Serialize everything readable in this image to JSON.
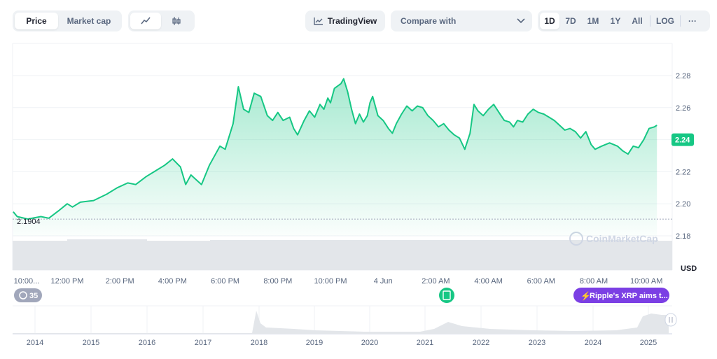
{
  "toolbar": {
    "metric_tabs": [
      {
        "label": "Price",
        "active": true
      },
      {
        "label": "Market cap",
        "active": false
      }
    ],
    "chart_style_icons": [
      "line-chart-icon",
      "candlestick-icon"
    ],
    "tradingview_label": "TradingView",
    "compare_label": "Compare with",
    "ranges": [
      {
        "label": "1D",
        "active": true
      },
      {
        "label": "7D",
        "active": false
      },
      {
        "label": "1M",
        "active": false
      },
      {
        "label": "1Y",
        "active": false
      },
      {
        "label": "All",
        "active": false
      },
      {
        "label": "LOG",
        "active": false
      }
    ],
    "more_label": "···"
  },
  "chart_data": {
    "type": "area",
    "y_ticks": [
      "2.18",
      "2.20",
      "2.22",
      "2.24",
      "2.26",
      "2.28"
    ],
    "ylim": [
      2.17,
      2.29
    ],
    "currency": "USD",
    "x_ticks": [
      "10:00...",
      "12:00 PM",
      "2:00 PM",
      "4:00 PM",
      "6:00 PM",
      "8:00 PM",
      "10:00 PM",
      "4 Jun",
      "2:00 AM",
      "4:00 AM",
      "6:00 AM",
      "8:00 AM",
      "10:00 AM"
    ],
    "x_hours": [
      0,
      2,
      4,
      6,
      8,
      10,
      12,
      14,
      16,
      18,
      20,
      22,
      24
    ],
    "open_price": 2.1904,
    "open_label": "2.1904",
    "current_price": 2.24,
    "current_label": "2.24",
    "series": [
      {
        "values": [
          [
            -0.05,
            2.195
          ],
          [
            0.1,
            2.192
          ],
          [
            0.5,
            2.1905
          ],
          [
            1.0,
            2.192
          ],
          [
            1.3,
            2.191
          ],
          [
            1.7,
            2.196
          ],
          [
            2.0,
            2.2
          ],
          [
            2.2,
            2.198
          ],
          [
            2.5,
            2.201
          ],
          [
            3.0,
            2.202
          ],
          [
            3.5,
            2.206
          ],
          [
            3.9,
            2.21
          ],
          [
            4.3,
            2.213
          ],
          [
            4.6,
            2.212
          ],
          [
            5.0,
            2.217
          ],
          [
            5.3,
            2.22
          ],
          [
            5.7,
            2.224
          ],
          [
            6.0,
            2.228
          ],
          [
            6.3,
            2.223
          ],
          [
            6.5,
            2.212
          ],
          [
            6.7,
            2.218
          ],
          [
            6.9,
            2.215
          ],
          [
            7.1,
            2.212
          ],
          [
            7.4,
            2.224
          ],
          [
            7.8,
            2.236
          ],
          [
            8.0,
            2.234
          ],
          [
            8.3,
            2.25
          ],
          [
            8.5,
            2.273
          ],
          [
            8.7,
            2.259
          ],
          [
            8.9,
            2.257
          ],
          [
            9.1,
            2.269
          ],
          [
            9.35,
            2.267
          ],
          [
            9.6,
            2.255
          ],
          [
            9.8,
            2.252
          ],
          [
            10.0,
            2.257
          ],
          [
            10.2,
            2.252
          ],
          [
            10.45,
            2.254
          ],
          [
            10.6,
            2.247
          ],
          [
            10.75,
            2.243
          ],
          [
            11.0,
            2.252
          ],
          [
            11.2,
            2.258
          ],
          [
            11.4,
            2.254
          ],
          [
            11.6,
            2.262
          ],
          [
            11.75,
            2.259
          ],
          [
            11.9,
            2.266
          ],
          [
            12.0,
            2.263
          ],
          [
            12.15,
            2.272
          ],
          [
            12.4,
            2.275
          ],
          [
            12.5,
            2.278
          ],
          [
            12.65,
            2.27
          ],
          [
            12.8,
            2.259
          ],
          [
            12.95,
            2.25
          ],
          [
            13.1,
            2.256
          ],
          [
            13.25,
            2.251
          ],
          [
            13.4,
            2.255
          ],
          [
            13.5,
            2.263
          ],
          [
            13.6,
            2.267
          ],
          [
            13.8,
            2.255
          ],
          [
            14.0,
            2.252
          ],
          [
            14.2,
            2.247
          ],
          [
            14.35,
            2.244
          ],
          [
            14.5,
            2.25
          ],
          [
            14.7,
            2.256
          ],
          [
            14.9,
            2.261
          ],
          [
            15.1,
            2.258
          ],
          [
            15.3,
            2.261
          ],
          [
            15.5,
            2.26
          ],
          [
            15.7,
            2.255
          ],
          [
            15.9,
            2.252
          ],
          [
            16.1,
            2.248
          ],
          [
            16.3,
            2.25
          ],
          [
            16.5,
            2.246
          ],
          [
            16.7,
            2.243
          ],
          [
            16.9,
            2.241
          ],
          [
            17.1,
            2.234
          ],
          [
            17.3,
            2.244
          ],
          [
            17.45,
            2.262
          ],
          [
            17.6,
            2.258
          ],
          [
            17.8,
            2.255
          ],
          [
            18.0,
            2.259
          ],
          [
            18.2,
            2.262
          ],
          [
            18.4,
            2.257
          ],
          [
            18.6,
            2.252
          ],
          [
            18.8,
            2.251
          ],
          [
            18.95,
            2.248
          ],
          [
            19.1,
            2.252
          ],
          [
            19.3,
            2.251
          ],
          [
            19.5,
            2.256
          ],
          [
            19.7,
            2.259
          ],
          [
            19.9,
            2.257
          ],
          [
            20.1,
            2.256
          ],
          [
            20.3,
            2.254
          ],
          [
            20.5,
            2.252
          ],
          [
            20.7,
            2.249
          ],
          [
            20.9,
            2.246
          ],
          [
            21.1,
            2.247
          ],
          [
            21.3,
            2.245
          ],
          [
            21.5,
            2.241
          ],
          [
            21.7,
            2.245
          ],
          [
            21.9,
            2.237
          ],
          [
            22.05,
            2.234
          ],
          [
            22.3,
            2.236
          ],
          [
            22.6,
            2.238
          ],
          [
            22.9,
            2.236
          ],
          [
            23.1,
            2.233
          ],
          [
            23.3,
            2.231
          ],
          [
            23.5,
            2.236
          ],
          [
            23.7,
            2.235
          ],
          [
            23.9,
            2.24
          ],
          [
            24.1,
            2.247
          ],
          [
            24.3,
            2.248
          ],
          [
            24.4,
            2.249
          ]
        ]
      }
    ]
  },
  "overview": {
    "years": [
      "2014",
      "2015",
      "2016",
      "2017",
      "2018",
      "2019",
      "2020",
      "2021",
      "2022",
      "2023",
      "2024",
      "2025"
    ]
  },
  "markers": {
    "history_count": "35",
    "news_label": "Ripple's XRP aims t..."
  },
  "watermark": "CoinMarketCap",
  "colors": {
    "line": "#16c784",
    "accent_purple": "#7b3fe4",
    "badge_gray": "#a1a7bb"
  }
}
